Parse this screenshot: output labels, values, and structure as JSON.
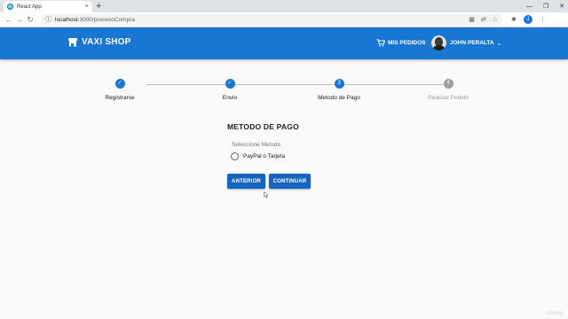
{
  "browser": {
    "tab_title": "React App",
    "tab_close": "×",
    "new_tab": "+",
    "win_min": "—",
    "win_max": "❐",
    "win_close": "✕",
    "back": "←",
    "forward": "→",
    "reload": "↻",
    "url_host": "localhost",
    "url_path": ":3000/procesoCompra",
    "profile_initial": "J"
  },
  "appbar": {
    "brand": "VAXI SHOP",
    "orders_label": "MIS PEDIDOS",
    "user_name": "JOHN PERALTA",
    "color": "#1976d2"
  },
  "stepper": {
    "steps": [
      {
        "label": "Registrarse",
        "state": "done",
        "content": "✓"
      },
      {
        "label": "Envio",
        "state": "done",
        "content": "✓"
      },
      {
        "label": "Metodo de Pago",
        "state": "active",
        "content": "3"
      },
      {
        "label": "Realizar Pedido",
        "state": "todo",
        "content": "4"
      }
    ]
  },
  "payment": {
    "title": "METODO DE PAGO",
    "legend": "Seleccione Metodo",
    "option_label": "PayPal o Tarjeta"
  },
  "buttons": {
    "previous": "ANTERIOR",
    "next": "CONTINUAR"
  },
  "watermark": "Udemy"
}
